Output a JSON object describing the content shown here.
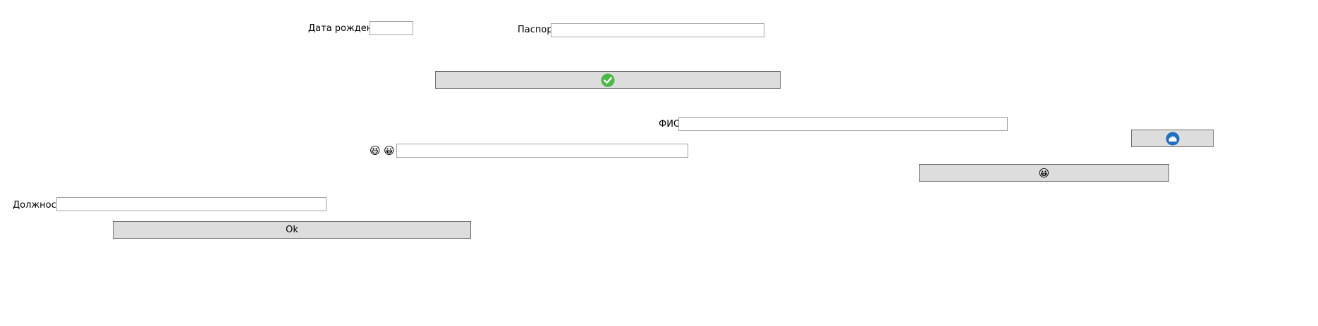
{
  "form": {
    "birth_date_label": "Дата рождения",
    "birth_date_value": "",
    "passport_label": "Паспорт",
    "passport_value": "",
    "fio_label": "ФИО",
    "fio_value": "",
    "emoji_field_value": "",
    "position_label": "Должность",
    "position_value": "",
    "ok_button_label": "Ok"
  },
  "icons": {
    "confirm_button_icon": "green-checkmark-icon",
    "blue_button_icon": "blue-circle-app-icon",
    "face_button_icon": "grinning-face-icon",
    "emoji_label_icons": [
      "grinning-squinting-face-icon",
      "grinning-face-icon"
    ]
  },
  "colors": {
    "checkmark_green": "#4cb848",
    "blue_icon": "#1e6fc0",
    "button_bg": "#dddddd",
    "button_border": "#6e6e6e",
    "field_border": "#a5a5a5"
  }
}
